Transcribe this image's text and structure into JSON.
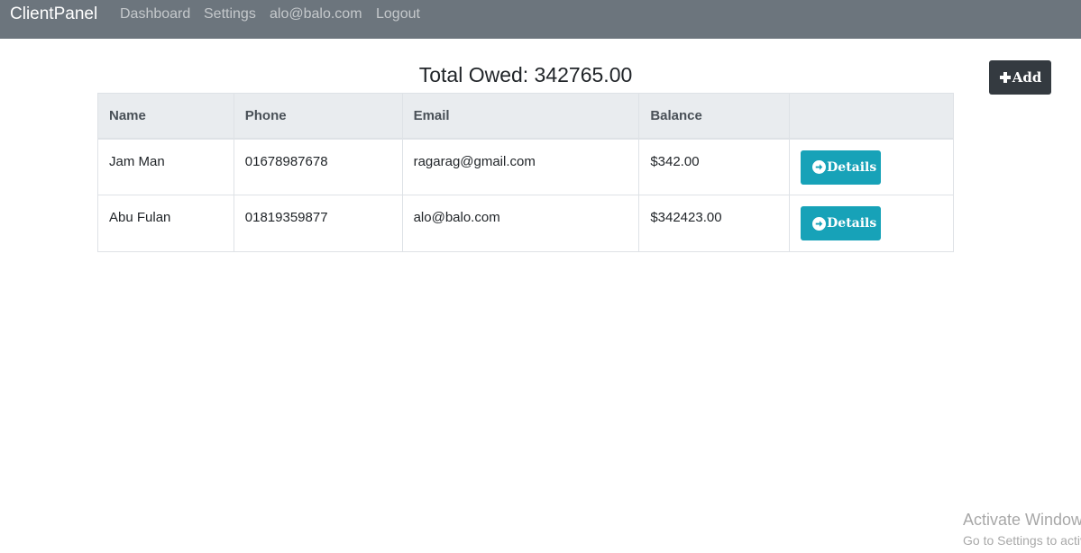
{
  "navbar": {
    "brand": "ClientPanel",
    "links": [
      {
        "label": "Dashboard"
      },
      {
        "label": "Settings"
      },
      {
        "label": "alo@balo.com"
      },
      {
        "label": "Logout"
      }
    ]
  },
  "main": {
    "title": "Total Owed: 342765.00",
    "add_label": "Add",
    "table": {
      "headers": [
        "Name",
        "Phone",
        "Email",
        "Balance",
        ""
      ],
      "rows": [
        {
          "name": "Jam Man",
          "phone": "01678987678",
          "email": "ragarag@gmail.com",
          "balance": "$342.00",
          "action_label": "Details"
        },
        {
          "name": "Abu Fulan",
          "phone": "01819359877",
          "email": "alo@balo.com",
          "balance": "$342423.00",
          "action_label": "Details"
        }
      ]
    }
  },
  "watermark": {
    "line1": "Activate Windows",
    "line2": "Go to Settings to activate Windows."
  },
  "colors": {
    "navbar_bg": "#6c757d",
    "add_button_bg": "#343a40",
    "details_button_bg": "#17a2b8",
    "table_header_bg": "#e9ecef"
  }
}
